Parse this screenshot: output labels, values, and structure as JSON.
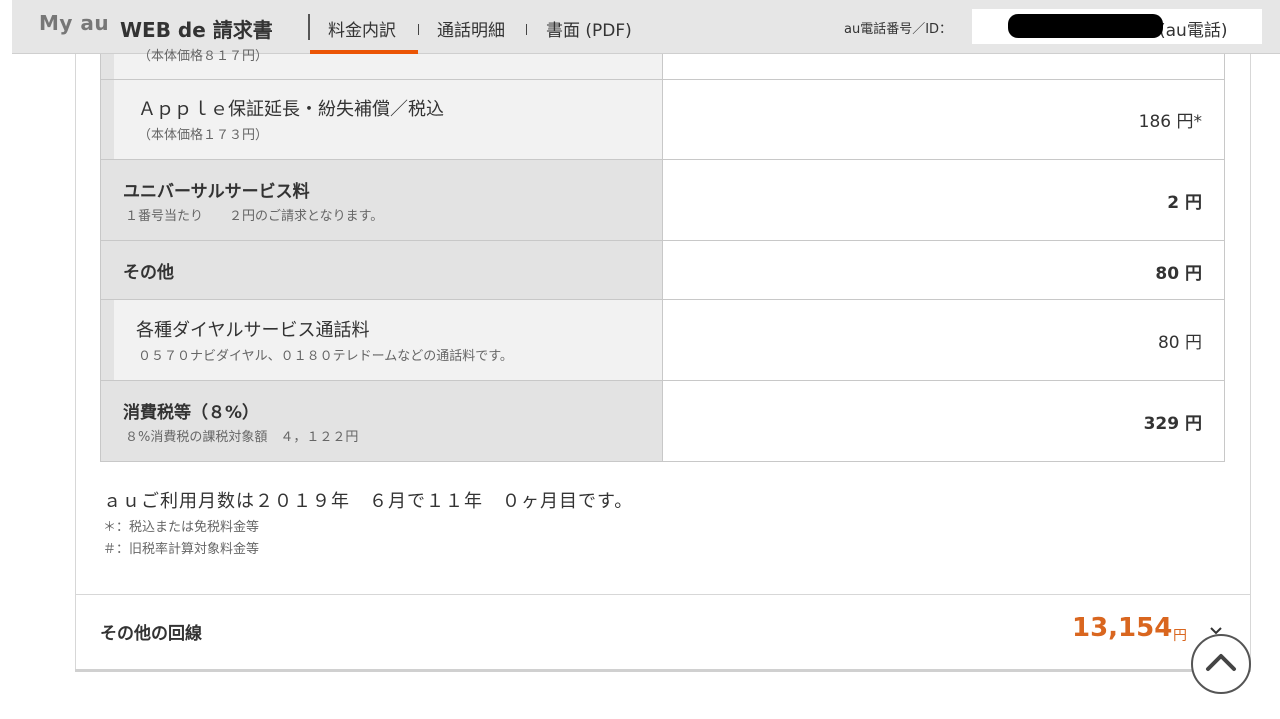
{
  "header": {
    "logo_myau": "My au",
    "logo_web": "WEB de 請求書",
    "tabs": [
      {
        "label": "料金内訳",
        "active": true
      },
      {
        "label": "通話明細",
        "active": false
      },
      {
        "label": "書面 (PDF)",
        "active": false
      }
    ],
    "phone_label": "au電話番号／ID：",
    "phone_value_suffix": "(au電話)"
  },
  "rows": [
    {
      "title": "",
      "note": "（本体価格８１７円）",
      "amount": ""
    },
    {
      "title": "Ａｐｐｌｅ保証延長・紛失補償／税込",
      "note": "（本体価格１７３円）",
      "amount": "186 円*"
    },
    {
      "title": "ユニバーサルサービス料",
      "note": "１番号当たり　　２円のご請求となります。",
      "amount": "2 円"
    },
    {
      "title": "その他",
      "note": "",
      "amount": "80 円"
    },
    {
      "title": "各種ダイヤルサービス通話料",
      "note": "０５７０ナビダイヤル、０１８０テレドームなどの通話料です。",
      "amount": "80 円"
    },
    {
      "title": "消費税等（８%）",
      "note": "８%消費税の課税対象額　４，１２２円",
      "amount": "329 円"
    }
  ],
  "summary": {
    "usage_months": "ａｕご利用月数は２０１９年　６月で１１年　０ヶ月目です。",
    "footnote_1": "＊：税込または免税料金等",
    "footnote_2": "＃：旧税率計算対象料金等"
  },
  "other_lines": {
    "label": "その他の回線",
    "amount": "13,154",
    "unit": "円"
  },
  "colors": {
    "accent": "#eb5505",
    "amount_orange": "#d9661f"
  }
}
